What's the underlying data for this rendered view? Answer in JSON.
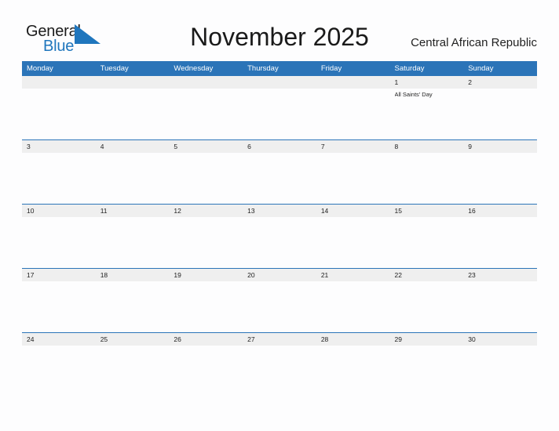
{
  "brand": {
    "word_one": "General",
    "word_two": "Blue",
    "flag_icon": "triangle-flag-icon",
    "color_blue": "#1f76bd",
    "color_dark": "#1b1b1b"
  },
  "header": {
    "title": "November 2025",
    "country": "Central African Republic"
  },
  "calendar": {
    "header_bg": "#2b74b8",
    "date_band_bg": "#efefef",
    "grid_line": "#2b74b8",
    "weekdays": [
      "Monday",
      "Tuesday",
      "Wednesday",
      "Thursday",
      "Friday",
      "Saturday",
      "Sunday"
    ],
    "weeks": [
      {
        "days": [
          {
            "date": "",
            "events": []
          },
          {
            "date": "",
            "events": []
          },
          {
            "date": "",
            "events": []
          },
          {
            "date": "",
            "events": []
          },
          {
            "date": "",
            "events": []
          },
          {
            "date": "1",
            "events": [
              "All Saints' Day"
            ]
          },
          {
            "date": "2",
            "events": []
          }
        ]
      },
      {
        "days": [
          {
            "date": "3",
            "events": []
          },
          {
            "date": "4",
            "events": []
          },
          {
            "date": "5",
            "events": []
          },
          {
            "date": "6",
            "events": []
          },
          {
            "date": "7",
            "events": []
          },
          {
            "date": "8",
            "events": []
          },
          {
            "date": "9",
            "events": []
          }
        ]
      },
      {
        "days": [
          {
            "date": "10",
            "events": []
          },
          {
            "date": "11",
            "events": []
          },
          {
            "date": "12",
            "events": []
          },
          {
            "date": "13",
            "events": []
          },
          {
            "date": "14",
            "events": []
          },
          {
            "date": "15",
            "events": []
          },
          {
            "date": "16",
            "events": []
          }
        ]
      },
      {
        "days": [
          {
            "date": "17",
            "events": []
          },
          {
            "date": "18",
            "events": []
          },
          {
            "date": "19",
            "events": []
          },
          {
            "date": "20",
            "events": []
          },
          {
            "date": "21",
            "events": []
          },
          {
            "date": "22",
            "events": []
          },
          {
            "date": "23",
            "events": []
          }
        ]
      },
      {
        "days": [
          {
            "date": "24",
            "events": []
          },
          {
            "date": "25",
            "events": []
          },
          {
            "date": "26",
            "events": []
          },
          {
            "date": "27",
            "events": []
          },
          {
            "date": "28",
            "events": []
          },
          {
            "date": "29",
            "events": []
          },
          {
            "date": "30",
            "events": []
          }
        ]
      }
    ]
  }
}
